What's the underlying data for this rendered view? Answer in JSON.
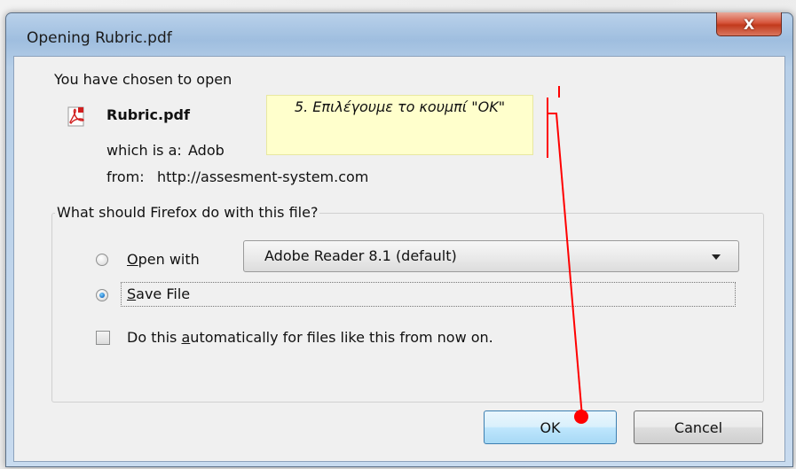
{
  "window": {
    "title": "Opening Rubric.pdf",
    "close_glyph": "X"
  },
  "intro": {
    "heading": "You have chosen to open",
    "file_name": "Rubric.pdf",
    "file_icon": "pdf-icon",
    "type_label": "which is a:",
    "type_value": "Adob",
    "from_label": "from:",
    "from_value": "http://assesment-system.com"
  },
  "group": {
    "legend": "What should Firefox do with this file?",
    "open_with": {
      "access_key": "O",
      "rest": "pen with",
      "selected": false,
      "app": "Adobe Reader 8.1 (default)"
    },
    "save_file": {
      "access_key": "S",
      "rest": "ave File",
      "selected": true
    },
    "auto": {
      "before": "Do this ",
      "access_key": "a",
      "after": "utomatically for files like this from now on.",
      "checked": false
    }
  },
  "buttons": {
    "ok": "OK",
    "cancel": "Cancel"
  },
  "annotation": {
    "text": "5. Επιλέγουμε το κουμπί \"OK\"",
    "pointer_color": "#ff0000"
  },
  "colors": {
    "close_button": "#d7553c",
    "title_bar": "#b9d1ea",
    "dialog_bg": "#f0f0f0",
    "annotation_bg": "#ffffcc"
  }
}
